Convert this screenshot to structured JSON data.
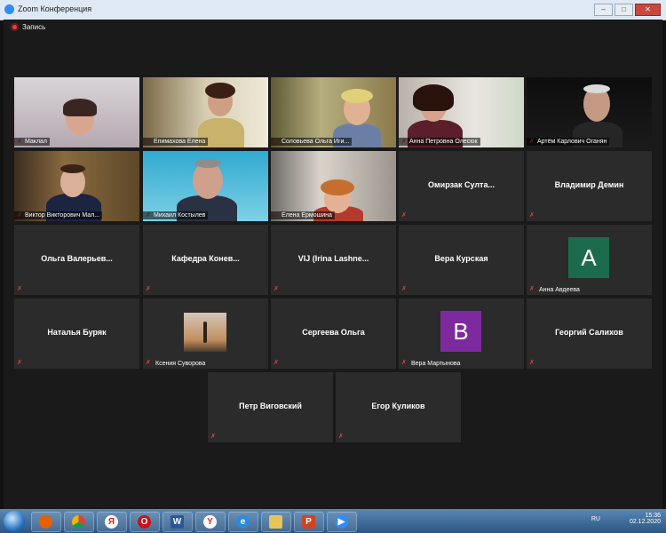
{
  "window": {
    "title": "Zoom Конференция",
    "buttons": [
      "–",
      "□",
      "✕"
    ]
  },
  "recording": {
    "label": "Запись"
  },
  "tiles": [
    {
      "name": "Маклал",
      "active": false
    },
    {
      "name": "Епимахова Елена",
      "active": false
    },
    {
      "name": "Соловьева Ольга Иги...",
      "active": true
    },
    {
      "name": "Анна Петровна Олесюк",
      "active": false
    },
    {
      "name": "Артём Карлович Оганян",
      "active": false
    },
    {
      "name": "Виктор Викторович Мал...",
      "active": false
    },
    {
      "name": "Михаил Костылев",
      "active": false
    },
    {
      "name": "Елена Ермошина",
      "active": false
    },
    {
      "name": "Омирзак Султа...",
      "active": false
    },
    {
      "name": "Владимир Демин",
      "active": false
    },
    {
      "name": "Ольга Валерьев...",
      "active": false
    },
    {
      "name": "Кафедра Конев...",
      "active": false
    },
    {
      "name": "VIJ (Irina Lashne...",
      "active": false
    },
    {
      "name": "Вера Курская",
      "active": false
    },
    {
      "name": "Анна Авдеева",
      "initial": "A",
      "avatar_color": "#1c6b4c"
    },
    {
      "name": "Наталья Буряк",
      "active": false
    },
    {
      "name": "Ксения Суворова",
      "active": false
    },
    {
      "name": "Сергеева Ольга",
      "active": false
    },
    {
      "name": "Вера Мартынова",
      "initial": "B",
      "avatar_color": "#7d2a9e"
    },
    {
      "name": "Георгий Салихов",
      "active": false
    },
    {
      "name": "Петр Виговский",
      "active": false
    },
    {
      "name": "Егор Куликов",
      "active": false
    }
  ],
  "taskbar": {
    "language": "RU",
    "time": "15:36",
    "date": "02.12.2020",
    "apps": [
      "start-button",
      "firefox-icon",
      "chrome-icon",
      "yandex-icon",
      "opera-icon",
      "word-icon",
      "yandex-browser-icon",
      "edge-icon",
      "explorer-icon",
      "powerpoint-icon",
      "zoom-icon"
    ]
  }
}
